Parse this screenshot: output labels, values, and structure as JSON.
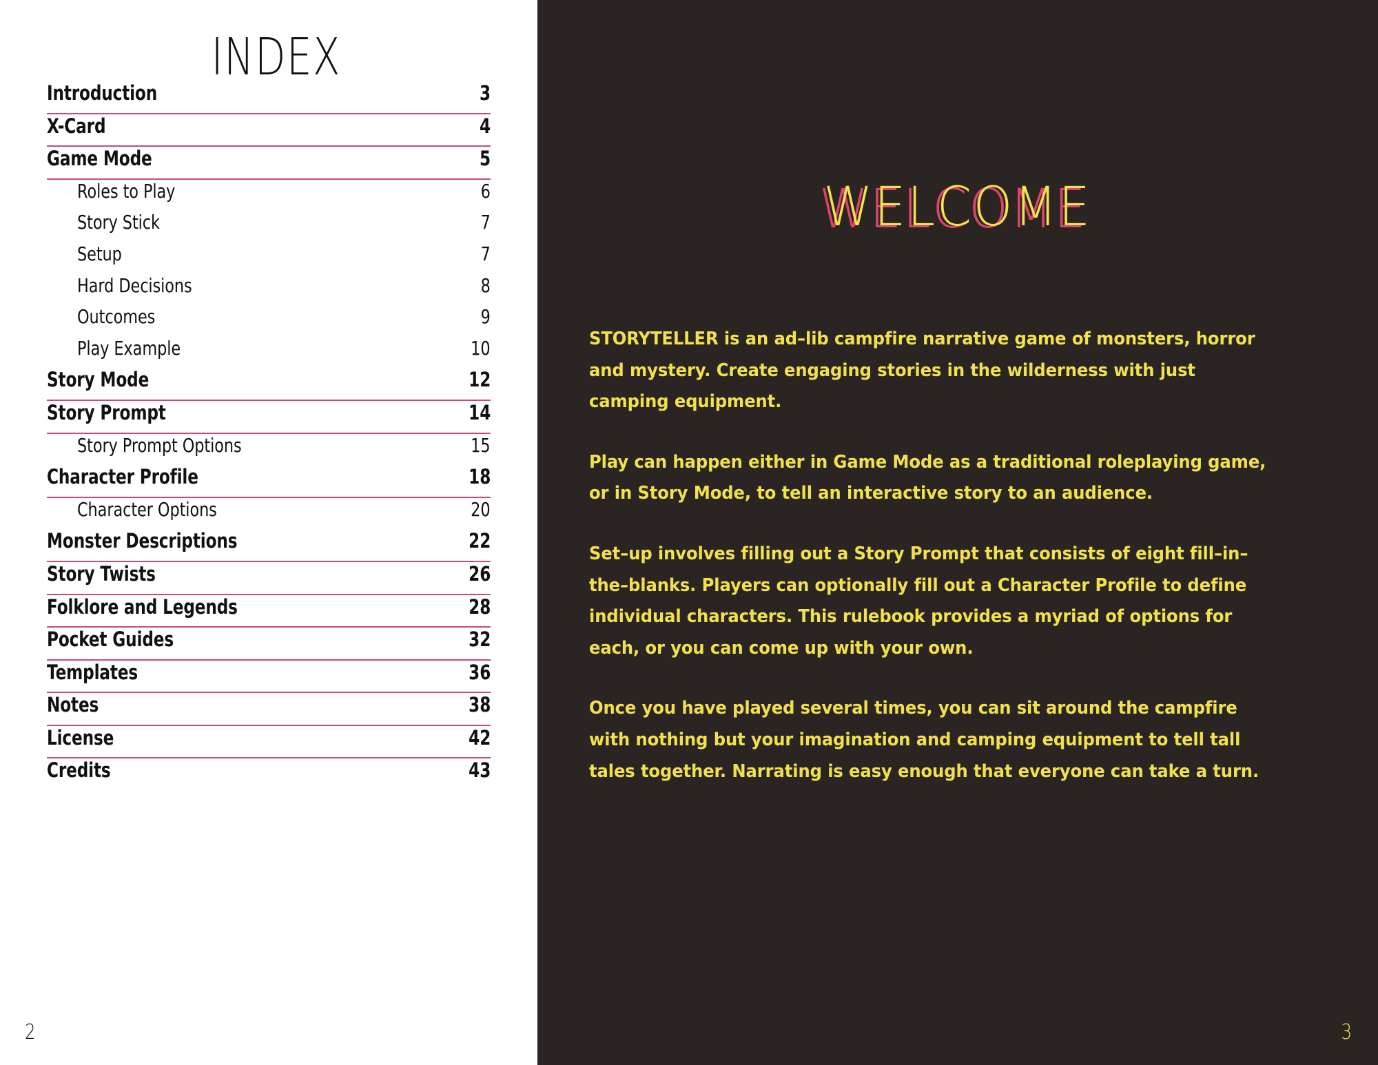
{
  "left_page": {
    "title": "INDEX",
    "folio": "2",
    "entries": [
      {
        "label": "Introduction",
        "page": "3",
        "level": 1,
        "rule": true
      },
      {
        "label": "X-Card",
        "page": "4",
        "level": 1,
        "rule": true
      },
      {
        "label": "Game Mode",
        "page": "5",
        "level": 1,
        "rule": true
      },
      {
        "label": "Roles to Play",
        "page": "6",
        "level": 2,
        "rule": false
      },
      {
        "label": "Story Stick",
        "page": "7",
        "level": 2,
        "rule": false
      },
      {
        "label": "Setup",
        "page": "7",
        "level": 2,
        "rule": false
      },
      {
        "label": "Hard Decisions",
        "page": "8",
        "level": 2,
        "rule": false
      },
      {
        "label": "Outcomes",
        "page": "9",
        "level": 2,
        "rule": false
      },
      {
        "label": "Play Example",
        "page": "10",
        "level": 2,
        "rule": false
      },
      {
        "label": "Story Mode",
        "page": "12",
        "level": 1,
        "rule": true
      },
      {
        "label": "Story Prompt",
        "page": "14",
        "level": 1,
        "rule": true
      },
      {
        "label": "Story Prompt Options",
        "page": "15",
        "level": 2,
        "rule": false
      },
      {
        "label": "Character Profile",
        "page": "18",
        "level": 1,
        "rule": true
      },
      {
        "label": "Character Options",
        "page": "20",
        "level": 2,
        "rule": false
      },
      {
        "label": "Monster Descriptions",
        "page": "22",
        "level": 1,
        "rule": true
      },
      {
        "label": "Story Twists",
        "page": "26",
        "level": 1,
        "rule": true
      },
      {
        "label": "Folklore and Legends",
        "page": "28",
        "level": 1,
        "rule": true
      },
      {
        "label": "Pocket Guides",
        "page": "32",
        "level": 1,
        "rule": true
      },
      {
        "label": "Templates",
        "page": "36",
        "level": 1,
        "rule": true
      },
      {
        "label": "Notes",
        "page": "38",
        "level": 1,
        "rule": true
      },
      {
        "label": "License",
        "page": "42",
        "level": 1,
        "rule": true
      },
      {
        "label": "Credits",
        "page": "43",
        "level": 1,
        "rule": false
      }
    ]
  },
  "right_page": {
    "title": "WELCOME",
    "folio": "3",
    "paragraphs": [
      "STORYTELLER is an ad–lib campfire narrative game of monsters, horror and mystery. Create engaging stories in the wilderness with just camping equipment.",
      "Play can happen either in Game Mode as a traditional roleplaying game, or in Story Mode, to tell an interactive story to an audience.",
      "Set–up involves filling out a Story Prompt that consists of eight fill–in–the–blanks. Players can optionally fill out a Character Profile to define individual characters. This rulebook provides a myriad of options for each, or you can come up with your own.",
      "Once you have played several times, you can sit around the campfire with nothing but your imagination and camping equipment to tell tall tales together. Narrating is easy enough that everyone can take a turn."
    ]
  },
  "colors": {
    "rule_pink": "#cc4a72",
    "dark_page": "#2a2523",
    "accent_yellow": "#f2e14a",
    "shadow_crimson": "#e0436a",
    "ink_black": "#111111"
  }
}
